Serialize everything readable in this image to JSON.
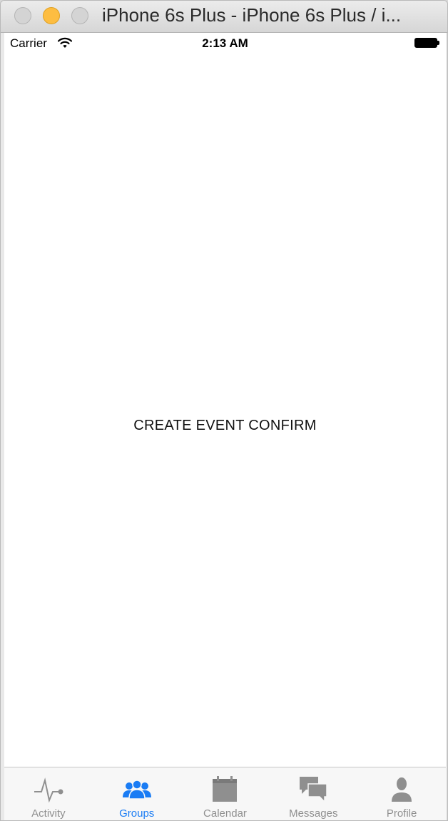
{
  "window": {
    "title": "iPhone 6s Plus - iPhone 6s Plus / i..."
  },
  "status_bar": {
    "carrier": "Carrier",
    "time": "2:13 AM",
    "icons": [
      "wifi-icon",
      "battery-icon"
    ]
  },
  "content": {
    "label": "CREATE EVENT CONFIRM"
  },
  "tab_bar": {
    "active_color": "#1a7cf4",
    "inactive_color": "#8f8f8f",
    "tabs": [
      {
        "label": "Activity",
        "icon": "activity-icon",
        "active": false
      },
      {
        "label": "Groups",
        "icon": "groups-icon",
        "active": true
      },
      {
        "label": "Calendar",
        "icon": "calendar-icon",
        "active": false
      },
      {
        "label": "Messages",
        "icon": "messages-icon",
        "active": false
      },
      {
        "label": "Profile",
        "icon": "profile-icon",
        "active": false
      }
    ]
  }
}
